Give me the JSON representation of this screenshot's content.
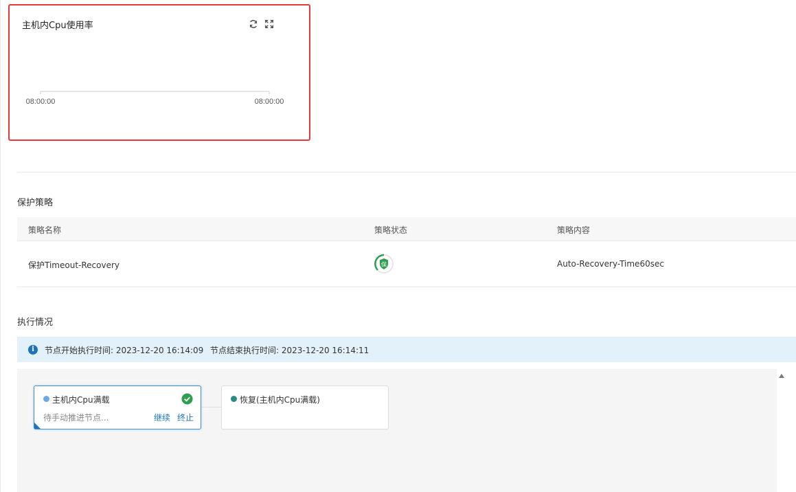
{
  "chart_card": {
    "title": "主机内Cpu使用率",
    "refresh_icon": "refresh-icon",
    "fullscreen_icon": "fullscreen-icon",
    "chart_data": {
      "type": "line",
      "title": "",
      "series": [],
      "x_ticks": [
        "08:00:00",
        "08:00:00"
      ],
      "xlabel": "",
      "ylabel": ""
    }
  },
  "strategy": {
    "section_title": "保护策略",
    "columns": [
      "策略名称",
      "策略状态",
      "策略内容"
    ],
    "rows": [
      {
        "name": "保护Timeout-Recovery",
        "status_badge": "保",
        "status_color": "#2e9e4f",
        "content": "Auto-Recovery-Time60sec"
      }
    ]
  },
  "execution": {
    "section_title": "执行情况",
    "info_icon": "i",
    "start_time": "节点开始执行时间: 2023-12-20 16:14:09",
    "end_time": "节点结束执行时间: 2023-12-20 16:14:11",
    "nodes": [
      {
        "title": "主机内Cpu满载",
        "dot_color": "#6fa8e0",
        "status": "待手动推进节点...",
        "actions": [
          "继续",
          "终止"
        ],
        "check_color": "#2e9e4f"
      },
      {
        "title": "恢复(主机内Cpu满载)",
        "dot_color": "#2a8a86"
      }
    ]
  }
}
